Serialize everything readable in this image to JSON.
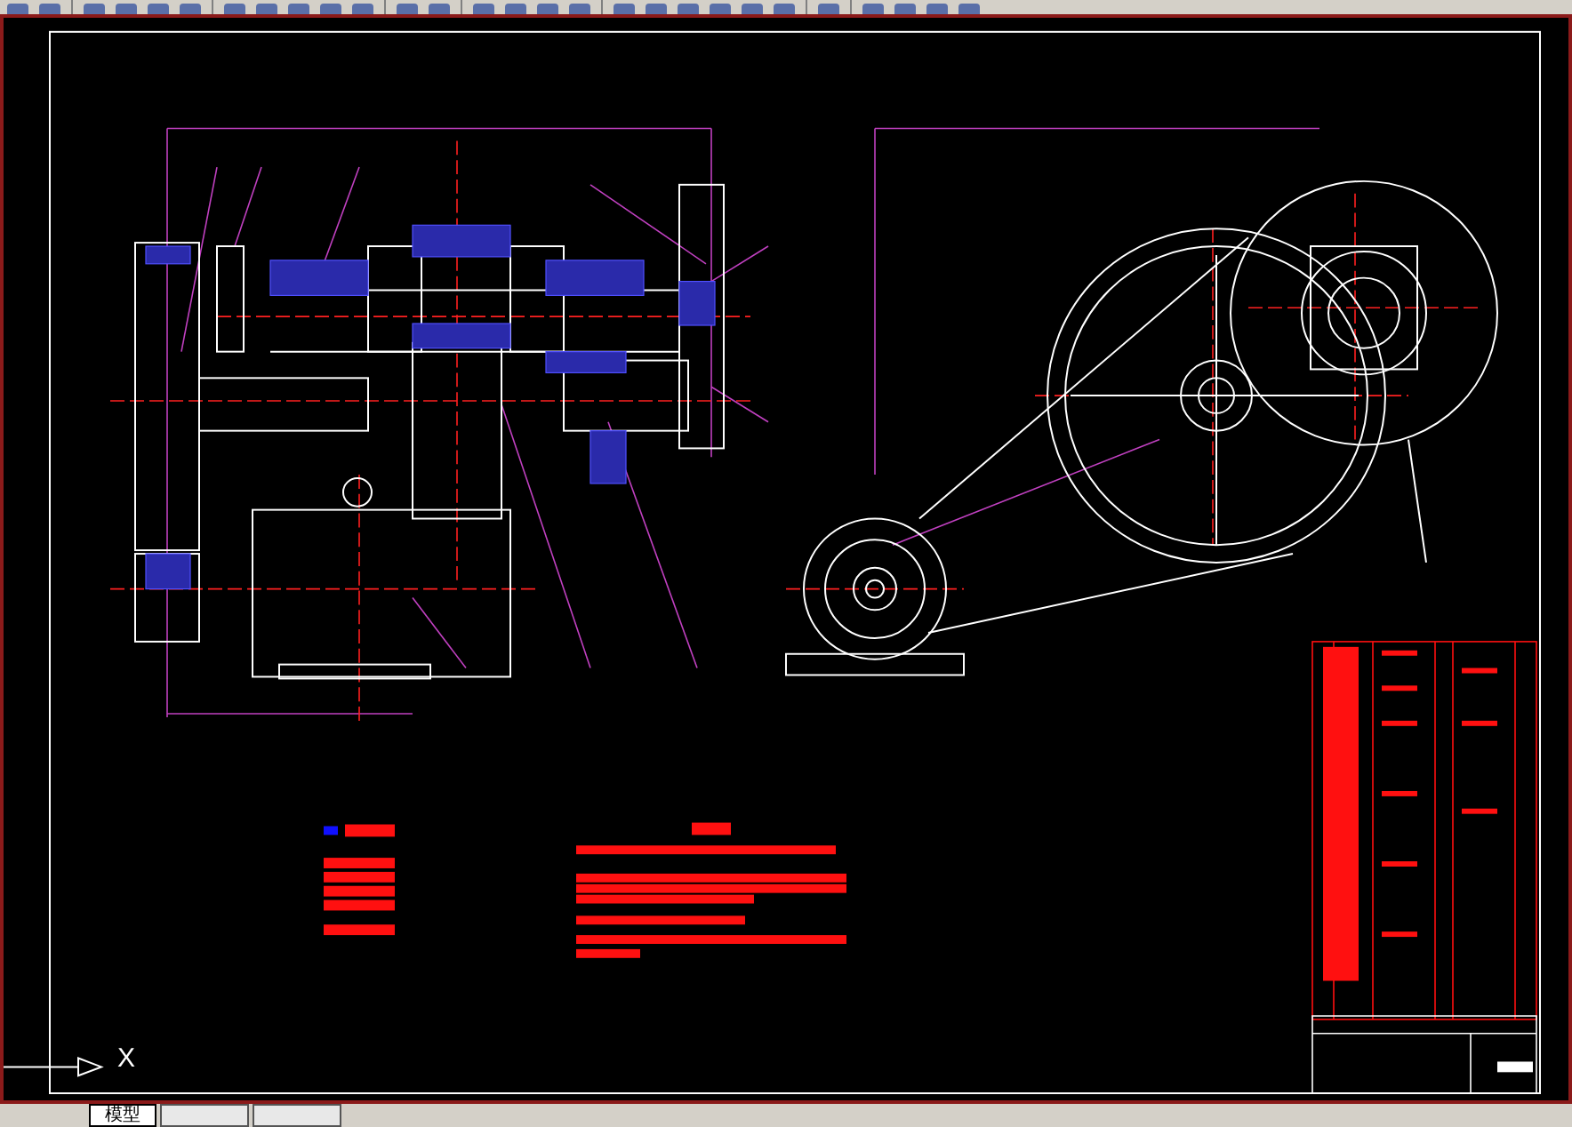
{
  "toolbar": [
    {
      "kind": "tool"
    },
    {
      "kind": "tool"
    },
    {
      "kind": "separator"
    },
    {
      "kind": "tool"
    },
    {
      "kind": "tool"
    },
    {
      "kind": "tool"
    },
    {
      "kind": "tool"
    },
    {
      "kind": "separator"
    },
    {
      "kind": "tool"
    },
    {
      "kind": "tool"
    },
    {
      "kind": "tool"
    },
    {
      "kind": "tool"
    },
    {
      "kind": "tool"
    },
    {
      "kind": "separator"
    },
    {
      "kind": "tool"
    },
    {
      "kind": "tool"
    },
    {
      "kind": "separator"
    },
    {
      "kind": "tool"
    },
    {
      "kind": "tool"
    },
    {
      "kind": "tool"
    },
    {
      "kind": "tool"
    },
    {
      "kind": "separator"
    },
    {
      "kind": "tool"
    },
    {
      "kind": "tool"
    },
    {
      "kind": "tool"
    },
    {
      "kind": "tool"
    },
    {
      "kind": "tool"
    },
    {
      "kind": "tool"
    },
    {
      "kind": "separator"
    },
    {
      "kind": "tool"
    },
    {
      "kind": "separator"
    },
    {
      "kind": "tool"
    },
    {
      "kind": "tool"
    },
    {
      "kind": "tool"
    },
    {
      "kind": "tool"
    }
  ],
  "ucs_axis_label": "X",
  "tabs": [
    {
      "label": "模型",
      "selected": true
    },
    {
      "selected": false
    },
    {
      "selected": false
    }
  ]
}
